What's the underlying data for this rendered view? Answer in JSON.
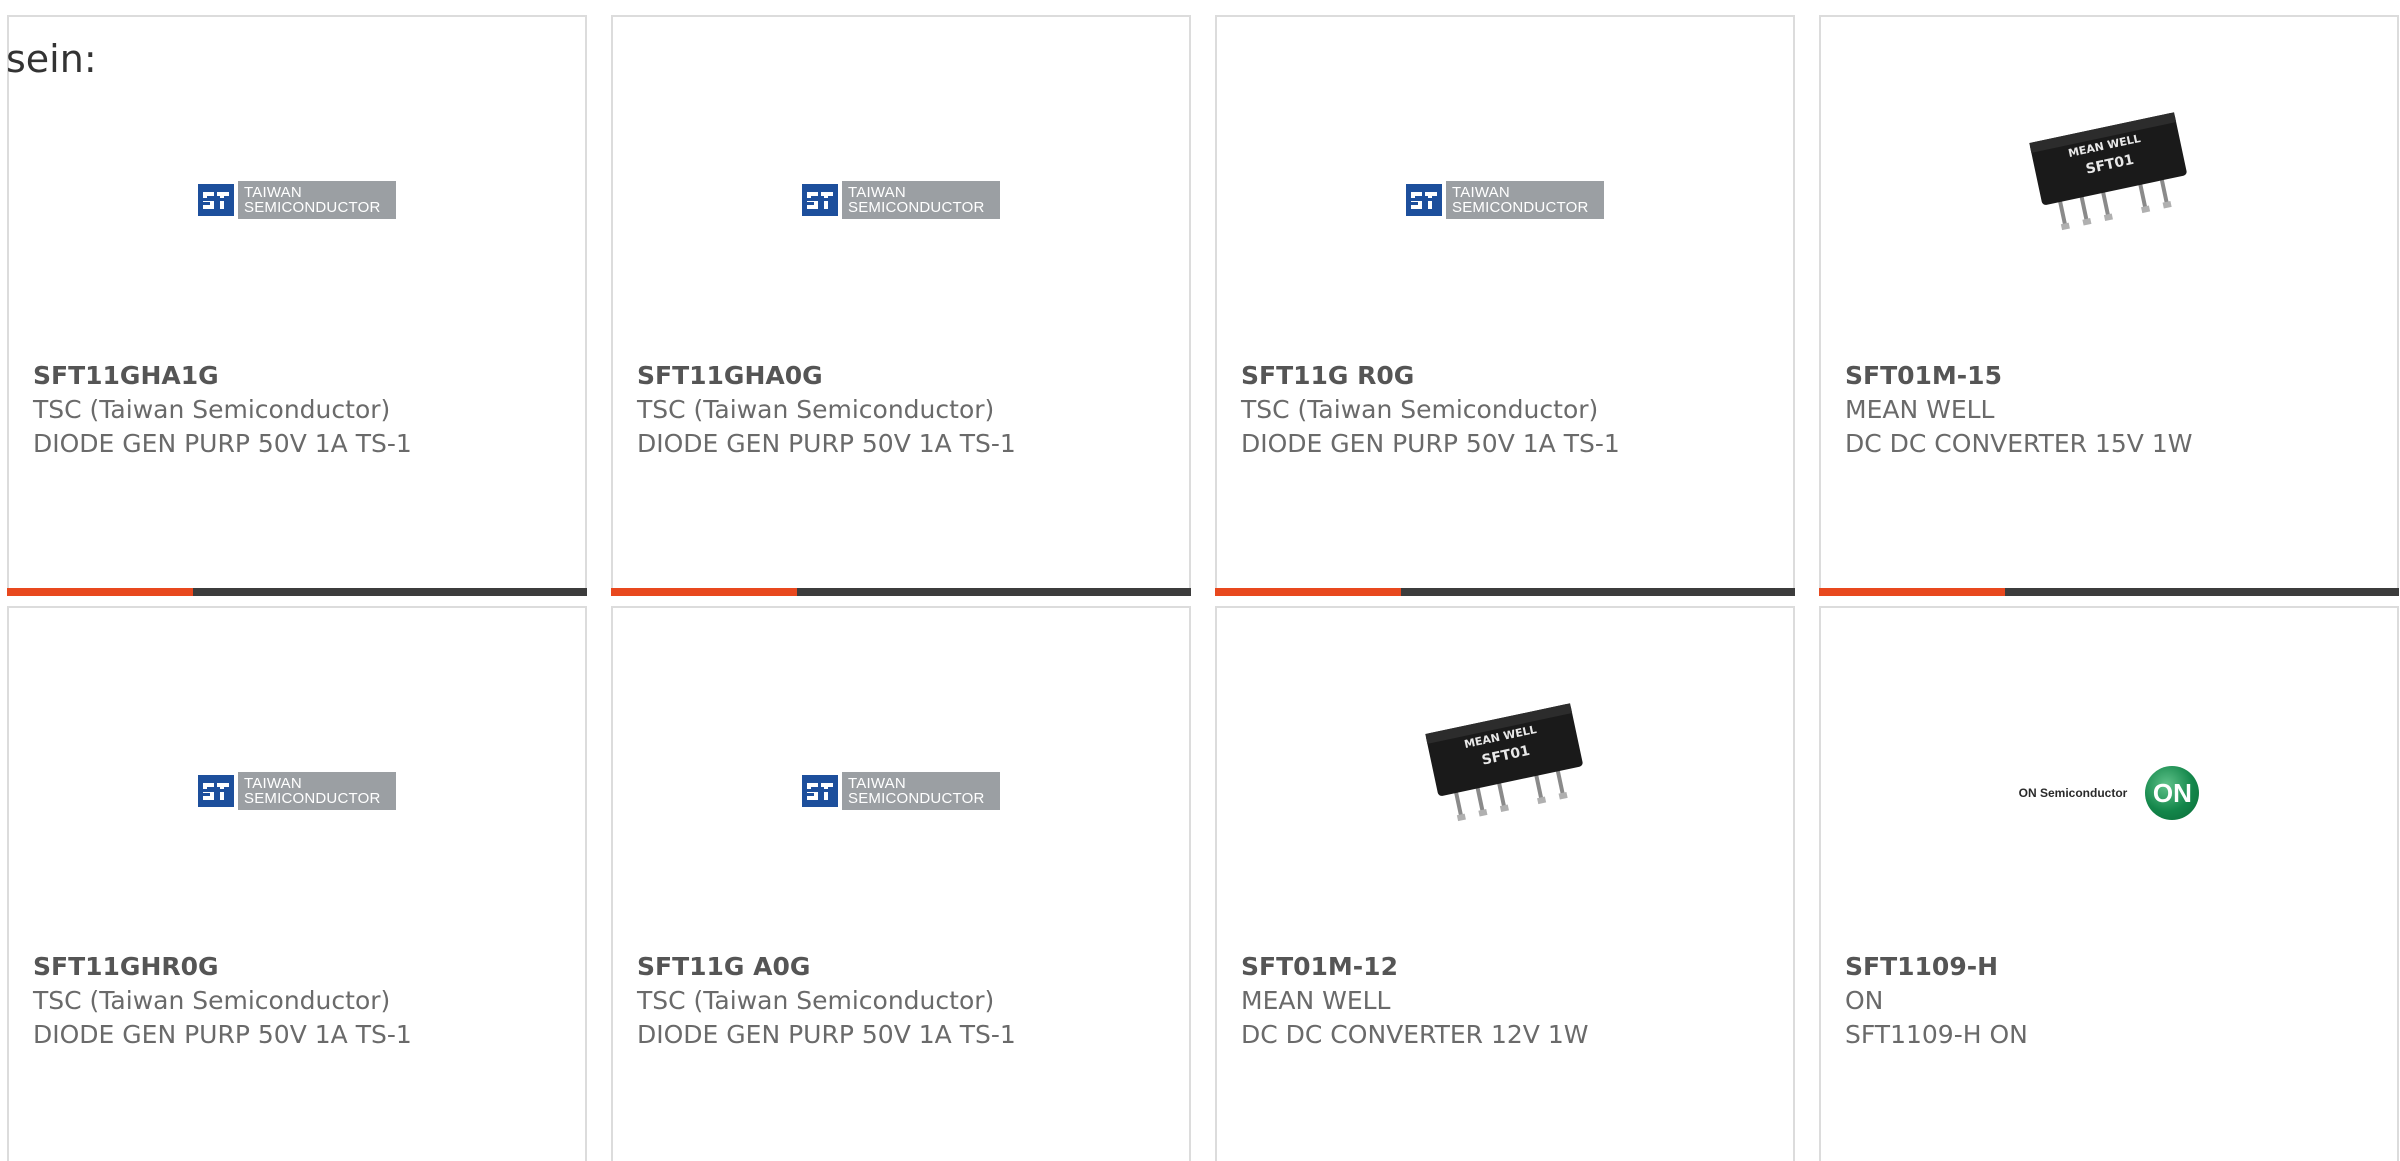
{
  "intro": "sein:",
  "colors": {
    "accent": "#e8481e",
    "track": "#3c3c3c",
    "border": "#dcdcdc"
  },
  "cards": [
    {
      "title": "SFT11GHA1G",
      "manufacturer": "TSC (Taiwan Semiconductor)",
      "description": "DIODE GEN PURP 50V 1A TS-1",
      "image": "taiwan-semiconductor-logo",
      "logo_lines": [
        "TAIWAN",
        "SEMICONDUCTOR"
      ],
      "progress": 0.32
    },
    {
      "title": "SFT11GHA0G",
      "manufacturer": "TSC (Taiwan Semiconductor)",
      "description": "DIODE GEN PURP 50V 1A TS-1",
      "image": "taiwan-semiconductor-logo",
      "logo_lines": [
        "TAIWAN",
        "SEMICONDUCTOR"
      ],
      "progress": 0.32
    },
    {
      "title": "SFT11G R0G",
      "manufacturer": "TSC (Taiwan Semiconductor)",
      "description": "DIODE GEN PURP 50V 1A TS-1",
      "image": "taiwan-semiconductor-logo",
      "logo_lines": [
        "TAIWAN",
        "SEMICONDUCTOR"
      ],
      "progress": 0.32
    },
    {
      "title": "SFT01M-15",
      "manufacturer": "MEAN WELL",
      "description": "DC DC CONVERTER 15V 1W",
      "image": "dc-dc-converter-chip",
      "chip_lines": [
        "MEAN WELL",
        "SFT01"
      ],
      "progress": 0.32
    },
    {
      "title": "SFT11GHR0G",
      "manufacturer": "TSC (Taiwan Semiconductor)",
      "description": "DIODE GEN PURP 50V 1A TS-1",
      "image": "taiwan-semiconductor-logo",
      "logo_lines": [
        "TAIWAN",
        "SEMICONDUCTOR"
      ]
    },
    {
      "title": "SFT11G A0G",
      "manufacturer": "TSC (Taiwan Semiconductor)",
      "description": "DIODE GEN PURP 50V 1A TS-1",
      "image": "taiwan-semiconductor-logo",
      "logo_lines": [
        "TAIWAN",
        "SEMICONDUCTOR"
      ]
    },
    {
      "title": "SFT01M-12",
      "manufacturer": "MEAN WELL",
      "description": "DC DC CONVERTER 12V 1W",
      "image": "dc-dc-converter-chip",
      "chip_lines": [
        "MEAN WELL",
        "SFT01"
      ]
    },
    {
      "title": "SFT1109-H",
      "manufacturer": "ON",
      "description": "SFT1109-H ON",
      "image": "on-semiconductor-logo",
      "logo_lines": [
        "ON Semiconductor",
        "ON"
      ]
    }
  ]
}
